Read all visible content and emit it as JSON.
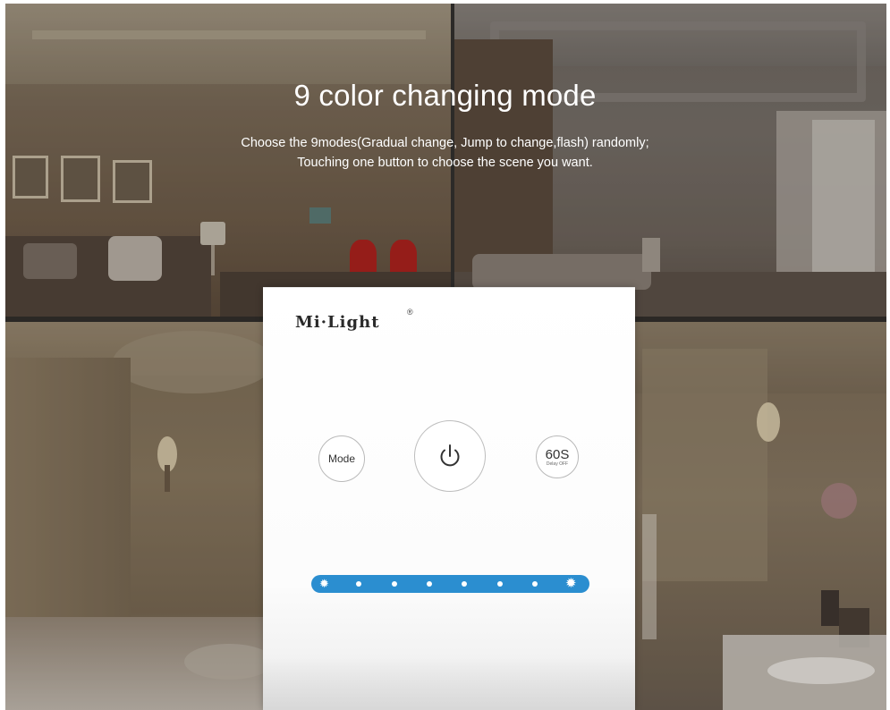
{
  "headline": "9 color changing mode",
  "subtitle_line1": "Choose the 9modes(Gradual change, Jump to change,flash) randomly;",
  "subtitle_line2": "Touching one button to choose the scene you want.",
  "panel": {
    "brand": "Mi·Light",
    "registered_mark": "®",
    "mode_button_label": "Mode",
    "power_icon": "power-icon",
    "delay_button_label": "60S",
    "delay_button_sublabel": "Delay OFF",
    "slider_left_icon": "sun-icon",
    "slider_right_icon": "sun-icon",
    "slider_dot_count": 6,
    "accent_color": "#2b8ed0"
  }
}
